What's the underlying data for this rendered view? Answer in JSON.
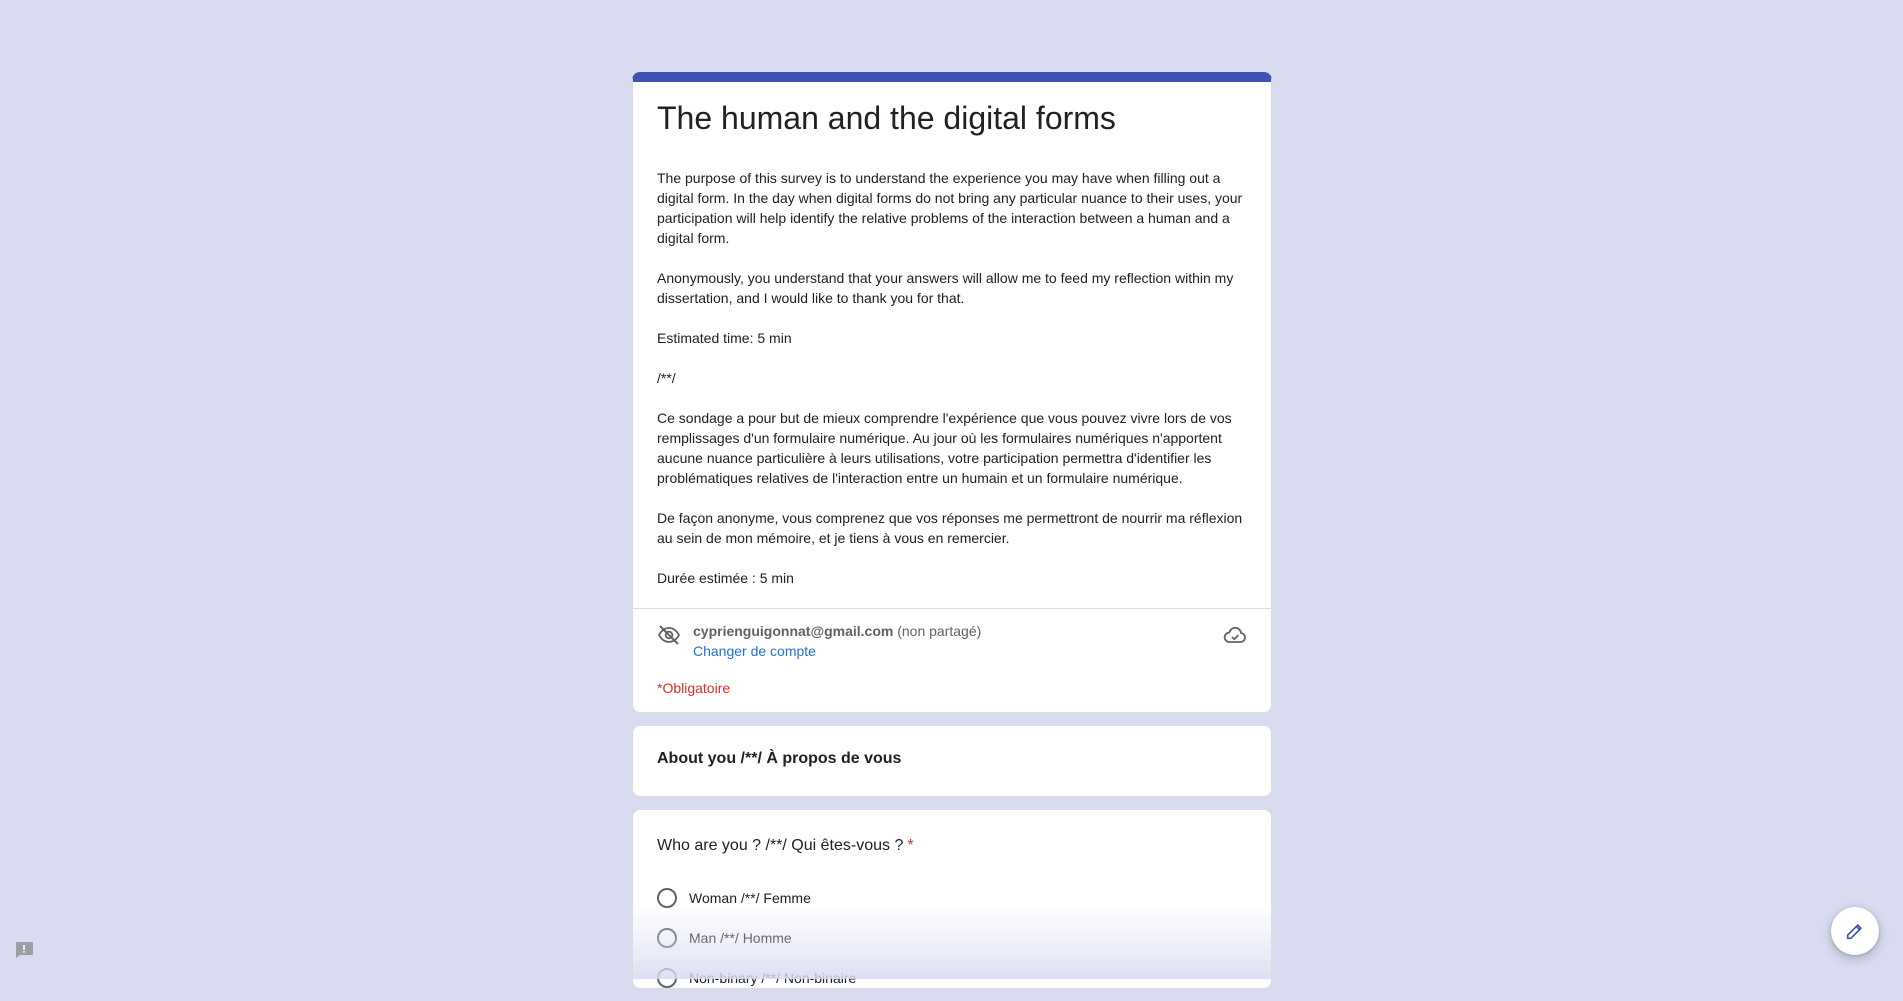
{
  "form": {
    "title": "The human and the digital forms",
    "description": "The purpose of this survey is to understand the experience you may have when filling out a digital form. In the day when digital forms do not bring any particular nuance to their uses, your participation will help identify the relative problems of the interaction between a human and a digital form.\n\nAnonymously, you understand that your answers will allow me to feed my reflection within my dissertation, and I would like to thank you for that.\n\nEstimated time: 5 min\n\n/**/\n\nCe sondage a pour but de mieux comprendre l'expérience que vous pouvez vivre lors de vos remplissages d'un formulaire numérique. Au jour où les formulaires numériques n'apportent aucune nuance particulière à leurs utilisations, votre participation permettra d'identifier les problématiques relatives de l'interaction entre un humain et un formulaire numérique.\n\nDe façon anonyme, vous comprenez que vos réponses me permettront de nourrir ma réflexion au sein de mon mémoire, et je tiens à vous en remercier.\n\nDurée estimée : 5 min",
    "accent_color": "#3f51b5"
  },
  "account": {
    "email": "cyprienguigonnat@gmail.com",
    "shared_status": "(non partagé)",
    "switch_label": "Changer de compte",
    "visibility_icon": "eye-off-icon",
    "save_icon": "cloud-icon"
  },
  "required_note": "*Obligatoire",
  "section": {
    "title": "About you /**/ À propos de vous"
  },
  "question": {
    "title": "Who are you ? /**/ Qui êtes-vous ?",
    "required_mark": "*",
    "options": [
      {
        "label": "Woman /**/ Femme"
      },
      {
        "label": "Man /**/ Homme"
      },
      {
        "label": "Non-binary /**/ Non-binaire"
      }
    ]
  }
}
